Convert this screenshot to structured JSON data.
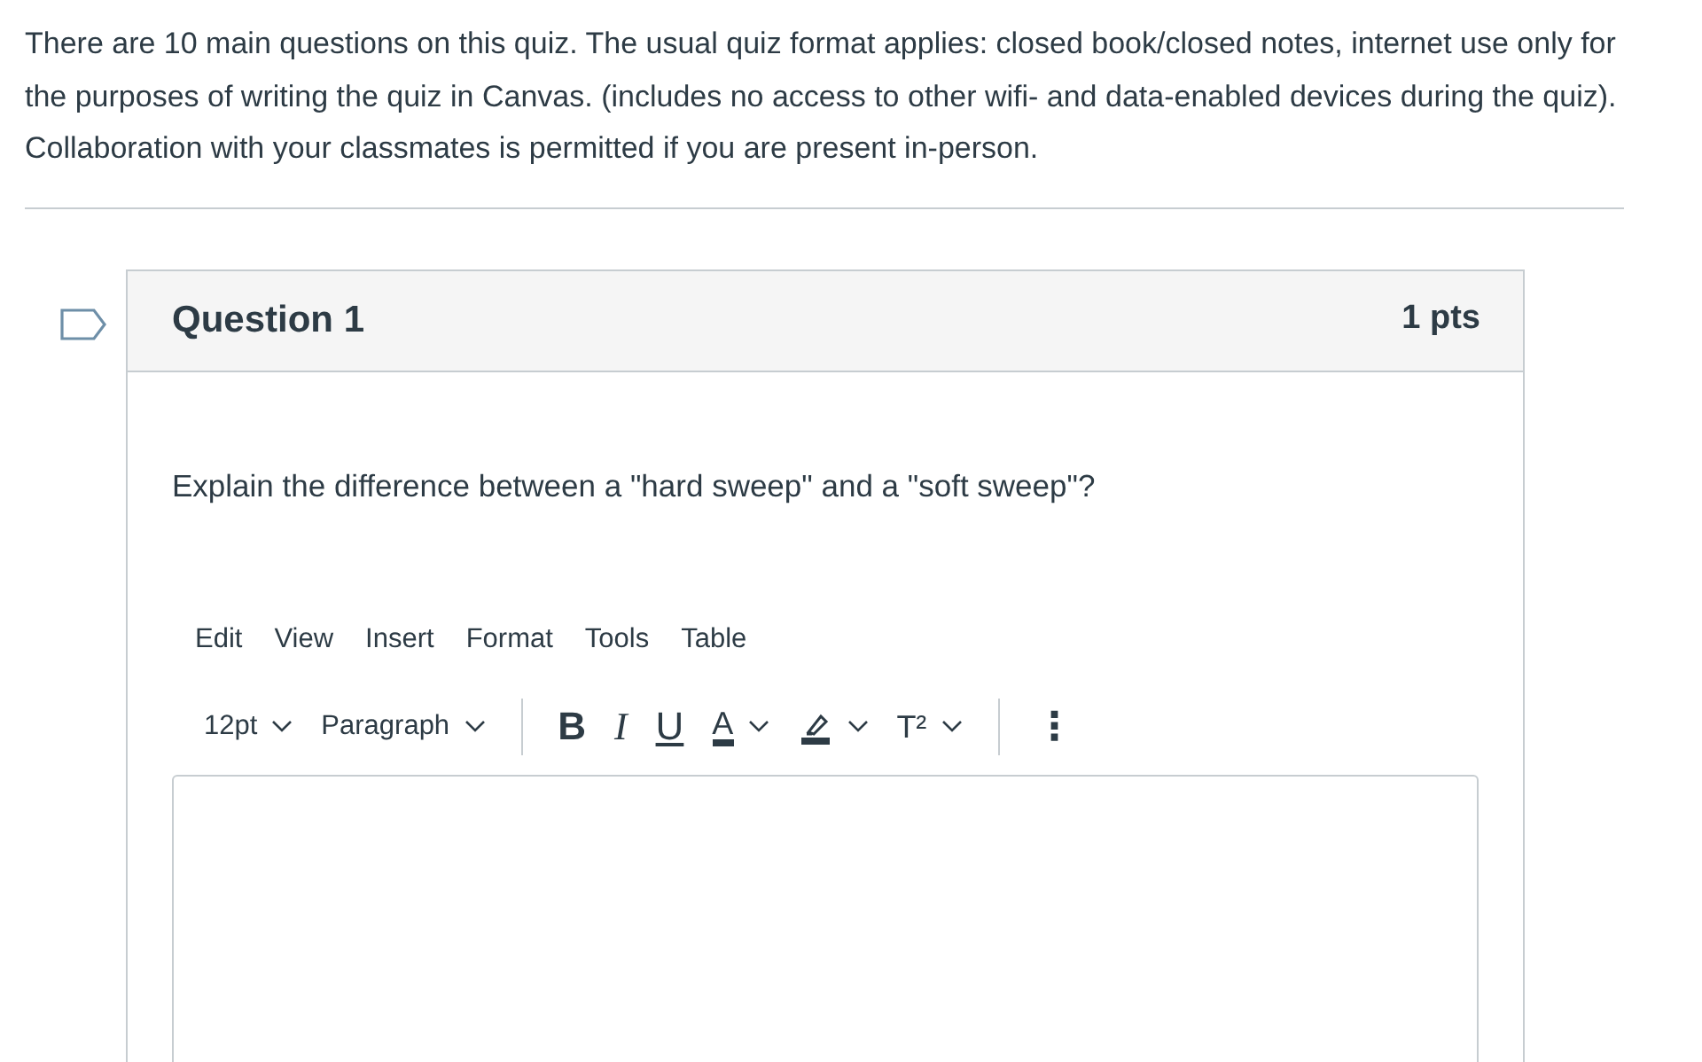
{
  "intro": "There are 10 main questions on this quiz. The usual quiz format applies: closed book/closed notes, internet use only for the purposes of writing the quiz in Canvas. (includes no access to other wifi- and data-enabled devices during the quiz). Collaboration with your classmates is permitted if you are present in-person.",
  "question": {
    "flagged": false,
    "title": "Question 1",
    "points": "1 pts",
    "text": "Explain the difference between a \"hard sweep\" and a \"soft sweep\"?",
    "editor": {
      "menu": [
        "Edit",
        "View",
        "Insert",
        "Format",
        "Tools",
        "Table"
      ],
      "toolbar": [
        {
          "kind": "dropdown",
          "label": "12pt"
        },
        {
          "kind": "dropdown",
          "label": "Paragraph"
        },
        {
          "kind": "divider"
        },
        {
          "kind": "bold",
          "label": "B"
        },
        {
          "kind": "italic",
          "label": "I"
        },
        {
          "kind": "underline",
          "label": "U"
        },
        {
          "kind": "color",
          "label": "A"
        },
        {
          "kind": "highlight"
        },
        {
          "kind": "superscript",
          "label": "T²"
        },
        {
          "kind": "divider"
        },
        {
          "kind": "more",
          "label": "⋮"
        }
      ]
    }
  }
}
